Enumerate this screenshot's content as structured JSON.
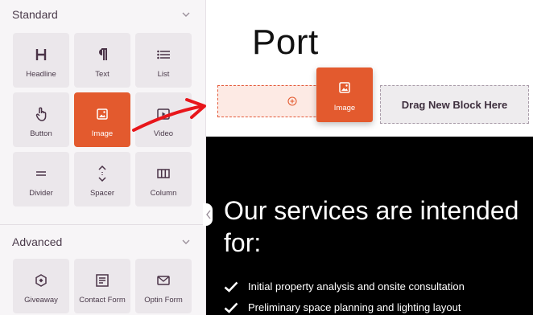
{
  "sidebar": {
    "standard": {
      "title": "Standard",
      "blocks": [
        {
          "label": "Headline",
          "icon": "headline-icon"
        },
        {
          "label": "Text",
          "icon": "paragraph-icon"
        },
        {
          "label": "List",
          "icon": "list-icon"
        },
        {
          "label": "Button",
          "icon": "pointer-icon"
        },
        {
          "label": "Image",
          "icon": "image-icon",
          "active": true
        },
        {
          "label": "Video",
          "icon": "video-icon"
        },
        {
          "label": "Divider",
          "icon": "divider-icon"
        },
        {
          "label": "Spacer",
          "icon": "spacer-icon"
        },
        {
          "label": "Column",
          "icon": "column-icon"
        }
      ]
    },
    "advanced": {
      "title": "Advanced",
      "blocks": [
        {
          "label": "Giveaway",
          "icon": "giveaway-icon"
        },
        {
          "label": "Contact Form",
          "icon": "contact-form-icon"
        },
        {
          "label": "Optin Form",
          "icon": "optin-form-icon"
        }
      ]
    }
  },
  "canvas": {
    "page_title": "Port",
    "drop_zone_plus": "⊕",
    "dragging_label": "Image",
    "drag_new_block": "Drag New Block Here",
    "heading": "Our services are intended for:",
    "services": [
      "Initial property analysis and onsite consultation",
      "Preliminary space planning and lighting layout"
    ]
  },
  "colors": {
    "accent": "#e35a2e",
    "sidebar_bg": "#f7f5f7",
    "tile_bg": "#ebe7eb",
    "dark_section": "#000000",
    "arrow": "#e8161b"
  }
}
